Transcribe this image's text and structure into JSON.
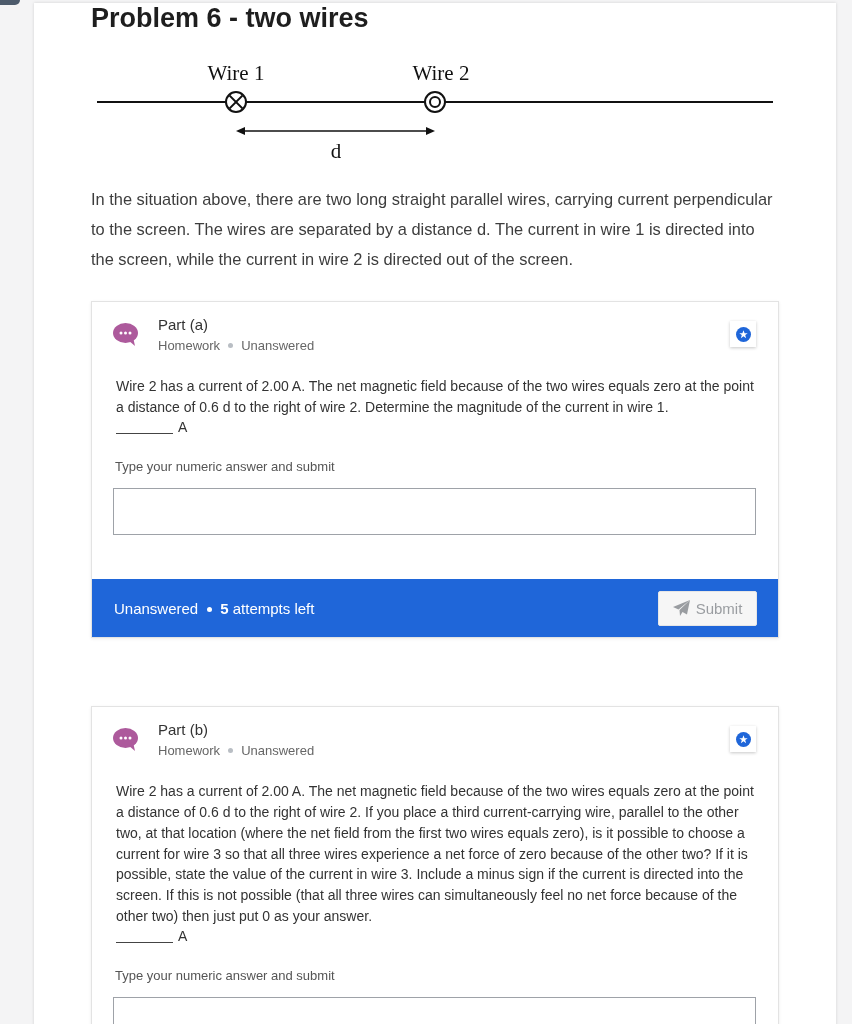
{
  "page": {
    "title": "Problem 6 - two wires"
  },
  "diagram": {
    "wires": [
      {
        "label": "Wire 1",
        "kind": "into"
      },
      {
        "label": "Wire 2",
        "kind": "out"
      }
    ],
    "distance_label": "d"
  },
  "description": "In the situation above, there are two long straight parallel wires, carrying current perpendicular to the screen. The wires are separated by a distance d. The current in wire 1 is directed into the screen, while the current in wire 2 is directed out of the screen.",
  "parts": [
    {
      "title": "Part (a)",
      "category": "Homework",
      "status": "Unanswered",
      "question": "Wire 2 has a current of 2.00 A. The net magnetic field because of the two wires equals zero at the point a distance of 0.6 d to the right of wire 2. Determine the magnitude of the current in wire 1.",
      "answer_unit": "A",
      "input_label": "Type your numeric answer and submit",
      "footer": {
        "status": "Unanswered",
        "attempts": "**5** attempts left",
        "submit": {
          "label": "Submit",
          "disabled": true
        }
      }
    },
    {
      "title": "Part (b)",
      "category": "Homework",
      "status": "Unanswered",
      "question": "Wire 2 has a current of 2.00 A. The net magnetic field because of the two wires equals zero at the point a distance of 0.6 d to the right of wire 2. If you place a third current-carrying wire, parallel to the other two, at that location (where the net field from the first two wires equals zero), is it possible to choose a current for wire 3 so that all three wires experience a net force of zero because of the other two? If it is possible, state the value of the current in wire 3. Include a minus sign if the current is directed into the screen. If this is not possible (that all three wires can simultaneously feel no net force because of the other two) then just put 0 as your answer.",
      "answer_unit": "A",
      "input_label": "Type your numeric answer and submit"
    }
  ]
}
